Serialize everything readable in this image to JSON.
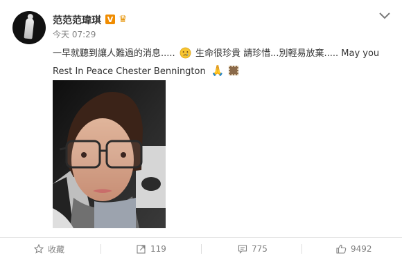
{
  "post": {
    "author": "范范范瑋琪",
    "verified_badge": "V",
    "time": "今天 07:29",
    "text_part1": "一早就聽到讓人難過的消息.....",
    "text_part2": "生命很珍貴 請珍惜...別輕易放棄.....  May you Rest In Peace Chester Bennington",
    "emojis": [
      "crying-face-icon",
      "praying-hands-icon",
      "stamp-icon"
    ],
    "photo": "selfie-photo"
  },
  "actions": {
    "favorite": {
      "label": "收藏",
      "icon": "star-icon"
    },
    "repost": {
      "count": "119",
      "icon": "repost-icon"
    },
    "comment": {
      "count": "775",
      "icon": "comment-icon"
    },
    "like": {
      "count": "9492",
      "icon": "thumbs-up-icon"
    }
  },
  "colors": {
    "badge": "#f08c00",
    "muted": "#808080",
    "text": "#333333"
  }
}
